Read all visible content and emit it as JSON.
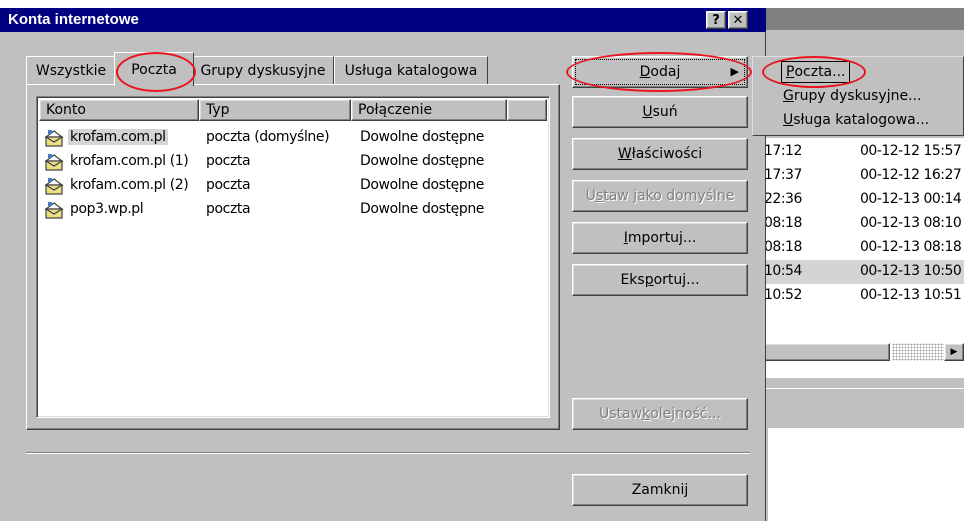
{
  "dialog": {
    "title": "Konta internetowe",
    "help_btn": "?",
    "close_btn": "✕"
  },
  "tabs": [
    {
      "label": "Wszystkie"
    },
    {
      "label": "Poczta"
    },
    {
      "label": "Grupy dyskusyjne"
    },
    {
      "label": "Usługa katalogowa"
    }
  ],
  "list": {
    "columns": [
      "Konto",
      "Typ",
      "Połączenie"
    ],
    "rows": [
      {
        "konto": "krofam.com.pl",
        "typ": "poczta (domyślne)",
        "polaczenie": "Dowolne dostępne"
      },
      {
        "konto": "krofam.com.pl (1)",
        "typ": "poczta",
        "polaczenie": "Dowolne dostępne"
      },
      {
        "konto": "krofam.com.pl (2)",
        "typ": "poczta",
        "polaczenie": "Dowolne dostępne"
      },
      {
        "konto": "pop3.wp.pl",
        "typ": "poczta",
        "polaczenie": "Dowolne dostępne"
      }
    ]
  },
  "buttons": {
    "dodaj": {
      "pre": "",
      "key": "D",
      "post": "odaj"
    },
    "usun": {
      "pre": "",
      "key": "U",
      "post": "suń"
    },
    "wlasciwosci": {
      "pre": "",
      "key": "W",
      "post": "łaściwości"
    },
    "ustaw_domyslne": {
      "pre": "U",
      "key": "s",
      "post": "taw jako domyślne"
    },
    "importuj": {
      "pre": "",
      "key": "I",
      "post": "mportuj..."
    },
    "eksportuj": {
      "pre": "Eks",
      "key": "p",
      "post": "ortuj..."
    },
    "ustaw_kolejnosc": {
      "pre": "Ustaw ",
      "key": "k",
      "post": "olejność..."
    },
    "zamknij": "Zamknij"
  },
  "submenu": [
    {
      "pre": "",
      "key": "P",
      "post": "oczta..."
    },
    {
      "pre": "",
      "key": "G",
      "post": "rupy dyskusyjne..."
    },
    {
      "pre": "",
      "key": "U",
      "post": "sługa katalogowa..."
    }
  ],
  "background_list": [
    {
      "time": "17:12",
      "date": "00-12-12 15:57"
    },
    {
      "time": "17:37",
      "date": "00-12-12 16:27"
    },
    {
      "time": "22:36",
      "date": "00-12-13 00:14"
    },
    {
      "time": "08:18",
      "date": "00-12-13 08:10"
    },
    {
      "time": "08:18",
      "date": "00-12-13 08:18"
    },
    {
      "time": "10:54",
      "date": "00-12-13 10:50"
    },
    {
      "time": "10:52",
      "date": "00-12-13 10:51"
    }
  ],
  "colors": {
    "face": "#c0c0c0",
    "titlebar": "#000080",
    "annotation": "#e8141e"
  }
}
